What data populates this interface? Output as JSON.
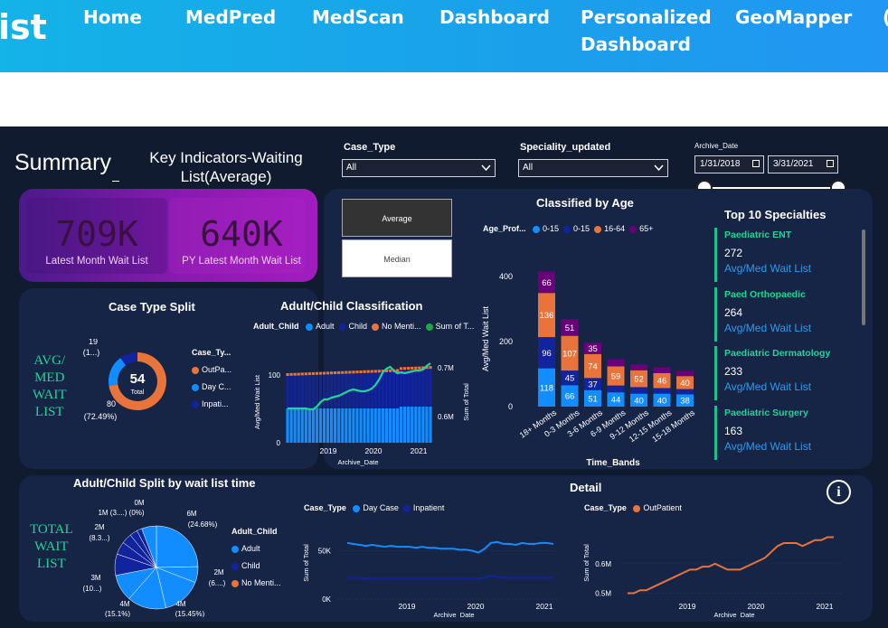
{
  "nav": {
    "logo_text": "ist",
    "links": [
      "Home",
      "MedPred",
      "MedScan",
      "Dashboard",
      "Personalized",
      "Dashboard",
      "GeoMapper",
      "("
    ]
  },
  "header": {
    "summary": "Summary",
    "key_title_line1": "Key Indicators-Waiting",
    "key_title_line2": "List(Average)"
  },
  "filters": {
    "case_type_label": "Case_Type",
    "case_type_value": "All",
    "speciality_label": "Speciality_updated",
    "speciality_value": "All",
    "archive_label": "Archive_Date",
    "date_from": "1/31/2018",
    "date_to": "3/31/2021"
  },
  "kpis": {
    "latest_value": "709K",
    "latest_label": "Latest Month Wait List",
    "py_value": "640K",
    "py_label": "PY Latest Month Wait List"
  },
  "toggle": {
    "average": "Average",
    "median": "Median"
  },
  "side_labels": {
    "avg_med_lines": [
      "AVG/",
      "MED",
      "WAIT",
      "LIST"
    ],
    "total_lines": [
      "TOTAL",
      "WAIT",
      "LIST"
    ]
  },
  "case_split": {
    "title": "Case Type Split",
    "center_value": "54",
    "center_label": "Total",
    "label_top": "19",
    "label_top2": "(1...)",
    "label_bottom": "80",
    "label_bottom2": "(72.49%)",
    "legend_title": "Case_Ty...",
    "legend": [
      {
        "name": "OutPa...",
        "color": "#e8743b"
      },
      {
        "name": "Day C...",
        "color": "#118dff"
      },
      {
        "name": "Inpati...",
        "color": "#12239e"
      }
    ],
    "slices": [
      {
        "value": 72.49,
        "color": "#e8743b"
      },
      {
        "value": 17.5,
        "color": "#118dff"
      },
      {
        "value": 10.01,
        "color": "#12239e"
      }
    ]
  },
  "adult_child": {
    "title": "Adult/Child Classification",
    "legend_title": "Adult_Child",
    "legend": [
      {
        "name": "Adult",
        "color": "#118dff"
      },
      {
        "name": "Child",
        "color": "#12239e"
      },
      {
        "name": "No Menti...",
        "color": "#e8743b"
      },
      {
        "name": "Sum of T...",
        "color": "#1aab40"
      }
    ],
    "ylabel": "Avg/Med Wait List",
    "y2label": "Sum of Total",
    "xlabel": "Archive_Date",
    "y_ticks": [
      "0",
      "100"
    ],
    "y2_ticks": [
      "0.6M",
      "0.7M"
    ],
    "x_ticks": [
      "2019",
      "2020",
      "2021"
    ]
  },
  "age_chart": {
    "title": "Classified by Age",
    "legend_title": "Age_Prof...",
    "legend": [
      {
        "name": "0-15",
        "color": "#118dff"
      },
      {
        "name": "0-15",
        "color": "#12239e"
      },
      {
        "name": "16-64",
        "color": "#e8743b"
      },
      {
        "name": "65+",
        "color": "#6b007b"
      }
    ],
    "ylabel": "Avg/Med Wait List",
    "xlabel": "Time_Bands",
    "y_ticks": [
      "0",
      "200",
      "400"
    ]
  },
  "chart_data": [
    {
      "type": "bar",
      "title": "Classified by Age",
      "xlabel": "Time_Bands",
      "ylabel": "Avg/Med Wait List",
      "ylim": [
        0,
        420
      ],
      "categories": [
        "18+ Months",
        "0-3 Months",
        "3-6 Months",
        "6-9 Months",
        "9-12 Months",
        "12-15 Months",
        "15-18 Months"
      ],
      "series": [
        {
          "name": "0-15",
          "color": "#118dff",
          "values": [
            118,
            66,
            51,
            44,
            40,
            40,
            38
          ]
        },
        {
          "name": "0-15",
          "color": "#12239e",
          "values": [
            96,
            45,
            37,
            21,
            20,
            17,
            16
          ]
        },
        {
          "name": "16-64",
          "color": "#e8743b",
          "values": [
            136,
            107,
            74,
            59,
            52,
            46,
            40
          ]
        },
        {
          "name": "65+",
          "color": "#6b007b",
          "values": [
            66,
            51,
            35,
            22,
            18,
            18,
            16
          ]
        }
      ],
      "labels": [
        {
          "series": 0,
          "values": [
            "118",
            "66",
            "51",
            "44",
            "40",
            "40",
            "38"
          ]
        },
        {
          "series": 1,
          "values": [
            "96",
            "45",
            "37",
            "",
            "",
            "",
            ""
          ]
        },
        {
          "series": 2,
          "values": [
            "136",
            "107",
            "74",
            "59",
            "52",
            "46",
            "40"
          ]
        },
        {
          "series": 3,
          "values": [
            "66",
            "51",
            "35",
            "",
            "",
            "",
            ""
          ]
        }
      ]
    },
    {
      "type": "line",
      "title": "Case_Type Day Case Inpatient",
      "xlabel": "Archive_Date",
      "ylabel": "Sum of Total",
      "y_ticks": [
        "0K",
        "50K"
      ],
      "x_ticks": [
        "2019",
        "2020",
        "2021"
      ],
      "ylim": [
        0,
        70000
      ],
      "series": [
        {
          "name": "Day Case",
          "color": "#118dff",
          "values": [
            58,
            57,
            56,
            55,
            56,
            55,
            54,
            55,
            54,
            54,
            54,
            53,
            54,
            53,
            53,
            52,
            52,
            52,
            51,
            51,
            50,
            48,
            52,
            58,
            59,
            57,
            57,
            56,
            58,
            57,
            57,
            58,
            58,
            57
          ]
        },
        {
          "name": "Inpatient",
          "color": "#12239e",
          "values": [
            22,
            22,
            22,
            21,
            21,
            21,
            21,
            21,
            21,
            21,
            21,
            21,
            21,
            21,
            21,
            21,
            21,
            21,
            21,
            21,
            21,
            21,
            22,
            24,
            23,
            22,
            22,
            22,
            22,
            22,
            22,
            22,
            22,
            22
          ]
        }
      ]
    },
    {
      "type": "line",
      "title": "Case_Type OutPatient",
      "xlabel": "Archive_Date",
      "ylabel": "Sum of Total",
      "y_ticks": [
        "0.5M",
        "0.6M"
      ],
      "x_ticks": [
        "2019",
        "2020",
        "2021"
      ],
      "series": [
        {
          "name": "OutPatient",
          "color": "#e8743b",
          "values": [
            0.5,
            0.5,
            0.51,
            0.51,
            0.52,
            0.53,
            0.54,
            0.55,
            0.56,
            0.57,
            0.58,
            0.58,
            0.59,
            0.59,
            0.6,
            0.59,
            0.58,
            0.58,
            0.58,
            0.59,
            0.6,
            0.61,
            0.62,
            0.64,
            0.66,
            0.67,
            0.67,
            0.67,
            0.66,
            0.67,
            0.68,
            0.68,
            0.69,
            0.69
          ]
        }
      ]
    }
  ],
  "specialties": {
    "title": "Top 10 Specialties",
    "items": [
      {
        "name": "Paediatric ENT",
        "value": "272",
        "link": "Avg/Med Wait List"
      },
      {
        "name": "Paed Orthopaedic",
        "value": "264",
        "link": "Avg/Med Wait List"
      },
      {
        "name": "Paediatric Dermatology",
        "value": "233",
        "link": "Avg/Med Wait List"
      },
      {
        "name": "Paediatric Surgery",
        "value": "163",
        "link": "Avg/Med Wait List"
      }
    ]
  },
  "split_time": {
    "title": "Adult/Child Split by wait list time",
    "legend_title": "Adult_Child",
    "legend": [
      {
        "name": "Adult",
        "color": "#118dff"
      },
      {
        "name": "Child",
        "color": "#12239e"
      },
      {
        "name": "No Menti...",
        "color": "#e8743b"
      }
    ],
    "labels": [
      {
        "t": "0M"
      },
      {
        "t": "1M (3....) (0%)"
      },
      {
        "t": "2M"
      },
      {
        "t": "(8.3...)"
      },
      {
        "t": "3M"
      },
      {
        "t": "(10...)"
      },
      {
        "t": "4M"
      },
      {
        "t": "(15.1%)"
      },
      {
        "t": "6M"
      },
      {
        "t": "(24.68%)"
      },
      {
        "t": "2M"
      },
      {
        "t": "(6....)"
      },
      {
        "t": "4M"
      },
      {
        "t": "(15.45%)"
      }
    ]
  },
  "detail": {
    "title": "Detail",
    "chart1_legend_title": "Case_Type",
    "chart1_legend": [
      {
        "name": "Day Case",
        "color": "#118dff"
      },
      {
        "name": "Inpatient",
        "color": "#12239e"
      }
    ],
    "chart2_legend_title": "Case_Type",
    "chart2_legend": [
      {
        "name": "OutPatient",
        "color": "#e8743b"
      }
    ]
  }
}
